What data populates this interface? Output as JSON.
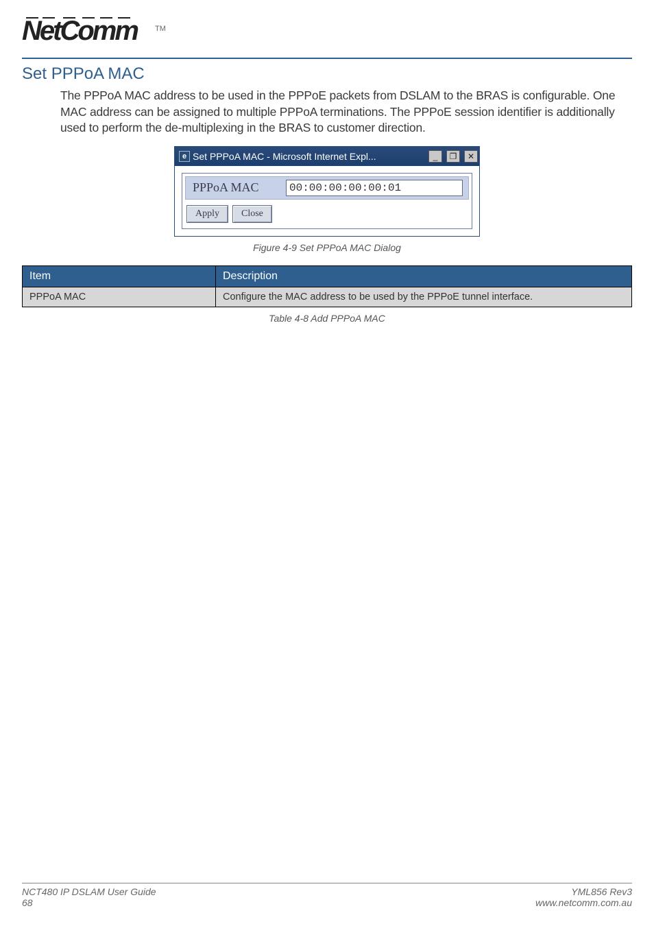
{
  "header": {
    "brand": "NetComm",
    "tm": "TM"
  },
  "section": {
    "heading": "Set PPPoA MAC",
    "paragraph": "The PPPoA MAC address to be used in the PPPoE packets from DSLAM to the BRAS is configurable. One MAC address can be assigned to multiple PPPoA terminations. The PPPoE session identifier is additionally used to perform the de-multiplexing in the BRAS to customer direction."
  },
  "dialog": {
    "title": "Set PPPoA MAC - Microsoft Internet Expl...",
    "field_label": "PPPoA MAC",
    "field_value": "00:00:00:00:00:01",
    "apply": "Apply",
    "close": "Close",
    "minimize_glyph": "_",
    "restore_glyph": "❐",
    "close_glyph": "✕"
  },
  "figure_caption": "Figure 4-9 Set PPPoA MAC Dialog",
  "table": {
    "headers": {
      "item": "Item",
      "description": "Description"
    },
    "rows": [
      {
        "item": "PPPoA MAC",
        "description": "Configure the MAC address to be used by the PPPoE tunnel interface."
      }
    ]
  },
  "table_caption": "Table 4-8 Add PPPoA MAC",
  "footer": {
    "left1": "NCT480 IP DSLAM User Guide",
    "left2": "68",
    "right1": "YML856 Rev3",
    "right2": "www.netcomm.com.au"
  }
}
